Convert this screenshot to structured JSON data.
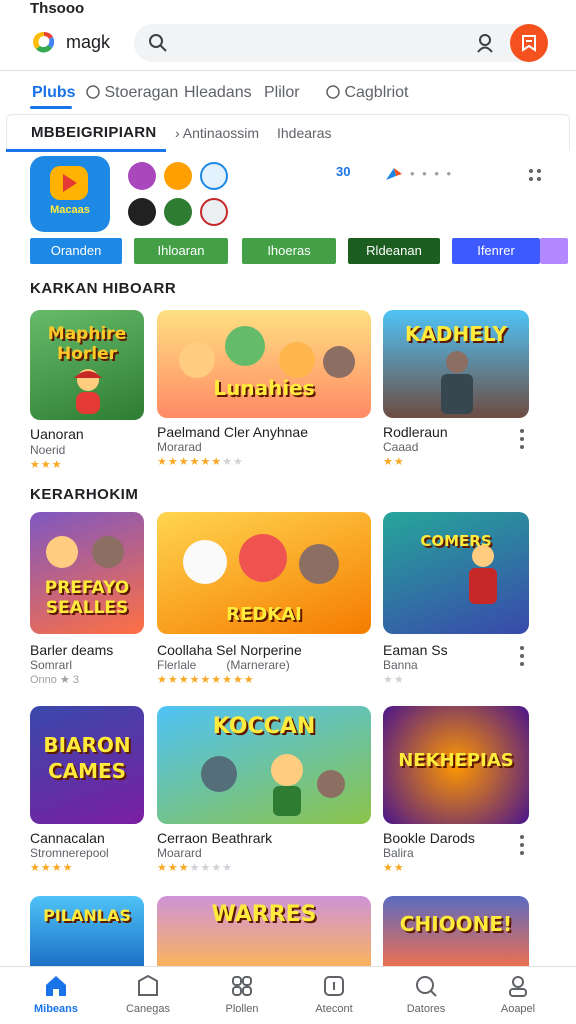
{
  "status_bar": {
    "time": "Thsooo"
  },
  "header": {
    "brand": "magk",
    "search_placeholder": ""
  },
  "tabs": [
    {
      "label": "Plubs",
      "active": true
    },
    {
      "label": "Stoeragan",
      "active": false
    },
    {
      "label": "Hleadans",
      "active": false
    },
    {
      "label": "Plilor",
      "active": false
    },
    {
      "label": "Cagblriot",
      "active": false
    }
  ],
  "subnav": {
    "title": "MBBEIGRIPIARN",
    "items": [
      "Antinaossim",
      "Ihdearas"
    ]
  },
  "hero": {
    "label": "Macaas",
    "badge": "30",
    "dots": "• • • •"
  },
  "chips": [
    {
      "label": "Oranden",
      "color": "#1e88e5"
    },
    {
      "label": "Ihloaran",
      "color": "#43a047"
    },
    {
      "label": "Ihoeras",
      "color": "#43a047"
    },
    {
      "label": "Rldeanan",
      "color": "#1b5e20"
    },
    {
      "label": "Ifenrer",
      "color": "#3d5afe"
    }
  ],
  "sections": [
    {
      "title": "KARKAN HIBOARR",
      "cards": [
        {
          "thumb_text": "Maphire Horler",
          "title": "Uanoran",
          "sub": "Noerid",
          "rating": 3,
          "star_count": 3
        },
        {
          "thumb_text": "Lunahies",
          "title": "Paelmand Cler Anyhnae",
          "sub": "Morarad",
          "rating": 5,
          "star_count": 8
        },
        {
          "thumb_text": "KADHELY",
          "title": "Rodleraun",
          "sub": "Caaad",
          "rating": 2,
          "star_count": 2
        }
      ]
    },
    {
      "title": "KERARHOKIM",
      "cards": [
        {
          "thumb_text": "PREFAYO SEALLES",
          "title": "Barler deams",
          "sub": "Somrarl",
          "rating": 0,
          "star_count": 0,
          "extra": "Onno ★ 3"
        },
        {
          "thumb_text": "REDKAI",
          "title": "Coollaha Sel Norperine",
          "sub": "Flerlale",
          "sub2": "(Marnerare)",
          "rating": 9,
          "star_count": 9
        },
        {
          "thumb_text": "COMERS",
          "title": "Eaman Ss",
          "sub": "Banna",
          "rating": 0,
          "star_count": 2
        }
      ]
    },
    {
      "title": "",
      "cards": [
        {
          "thumb_text": "BIARON CAMES",
          "title": "Cannacalan",
          "sub": "Stromnerepool",
          "rating": 4,
          "star_count": 4
        },
        {
          "thumb_text": "KOCCAN",
          "title": "Cerraon Beathrark",
          "sub": "Moarard",
          "rating": 3,
          "star_count": 7
        },
        {
          "thumb_text": "NEKHEPIAS",
          "title": "Bookle Darods",
          "sub": "Balira",
          "rating": 2,
          "star_count": 2
        }
      ]
    },
    {
      "title": "",
      "cards": [
        {
          "thumb_text": "PILANLAS",
          "title": "",
          "sub": "",
          "rating": 0,
          "star_count": 0
        },
        {
          "thumb_text": "WARRES",
          "title": "",
          "sub": "",
          "rating": 0,
          "star_count": 0
        },
        {
          "thumb_text": "CHIOONE!",
          "title": "",
          "sub": "",
          "rating": 0,
          "star_count": 0
        }
      ]
    }
  ],
  "bottom_nav": [
    {
      "label": "Mibeans",
      "icon": "home-icon",
      "active": true
    },
    {
      "label": "Canegas",
      "icon": "games-icon",
      "active": false
    },
    {
      "label": "Plollen",
      "icon": "apps-icon",
      "active": false
    },
    {
      "label": "Atecont",
      "icon": "offers-icon",
      "active": false
    },
    {
      "label": "Datores",
      "icon": "search-icon",
      "active": false
    },
    {
      "label": "Aoapel",
      "icon": "profile-icon",
      "active": false
    }
  ],
  "colors": {
    "accent": "#1a73e8",
    "avatar": "#f4511e",
    "star": "#f9a825"
  }
}
